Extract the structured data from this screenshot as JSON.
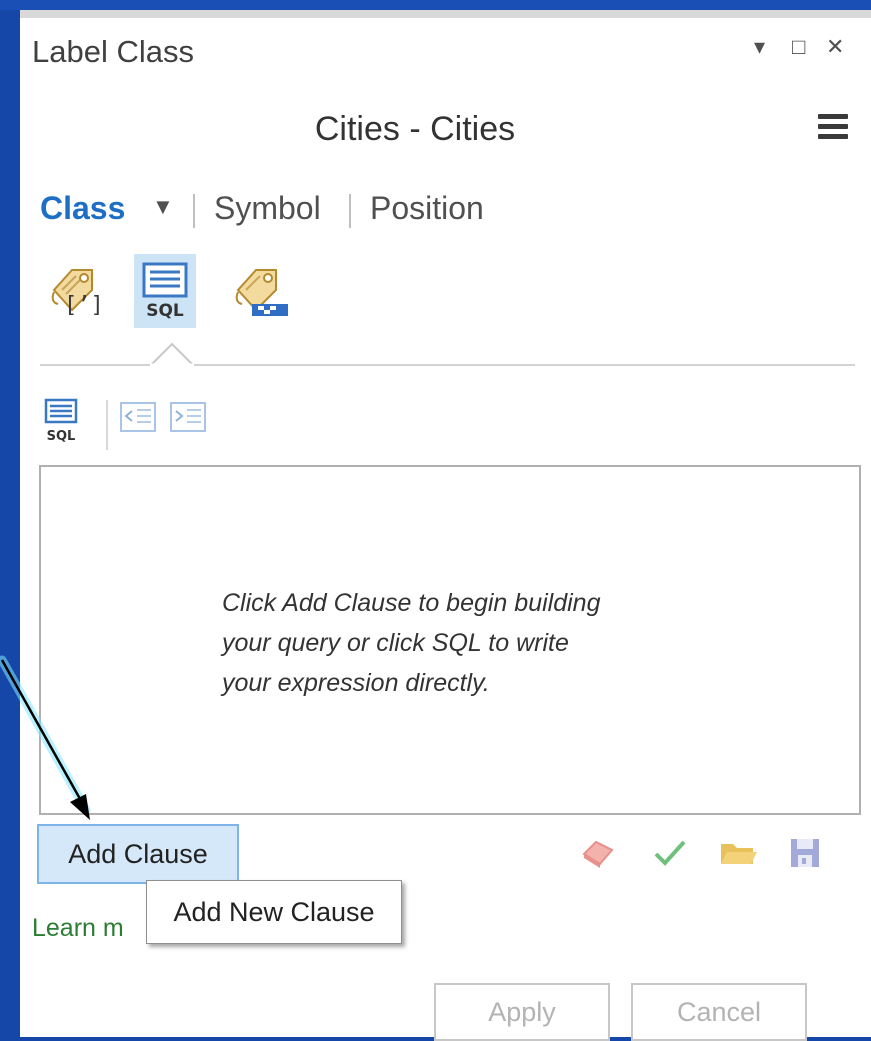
{
  "panel": {
    "title": "Label Class",
    "window_controls": {
      "dropdown": "▾",
      "maximize": "□",
      "close": "✕"
    },
    "subtitle": "Cities - Cities"
  },
  "tabs": [
    {
      "label": "Class",
      "selected": true
    },
    {
      "label": "Symbol",
      "selected": false
    },
    {
      "label": "Position",
      "selected": false
    }
  ],
  "tabs_dropdown": "▼",
  "mode_icons": [
    {
      "name": "label-expression-icon",
      "selected": false
    },
    {
      "name": "sql-query-icon",
      "label": "SQL",
      "selected": true
    },
    {
      "name": "visibility-range-icon",
      "selected": false
    }
  ],
  "toolbar": {
    "sql_label": "SQL",
    "icons": [
      "sql-toggle-icon",
      "outdent-icon",
      "indent-icon"
    ]
  },
  "query_message": {
    "lines": [
      "Click Add Clause to begin building",
      "your query or click SQL to write",
      "your expression directly."
    ]
  },
  "actions": {
    "add_clause": "Add Clause",
    "icons": [
      "eraser-icon",
      "verify-check-icon",
      "open-folder-icon",
      "save-icon"
    ],
    "learn_more": "Learn m",
    "tooltip": "Add New Clause",
    "apply": "Apply",
    "cancel": "Cancel"
  },
  "colors": {
    "background": "#1547a8",
    "accent_blue": "#1c6fc4",
    "selection": "#cde4f7",
    "link_green": "#2c7d34"
  }
}
